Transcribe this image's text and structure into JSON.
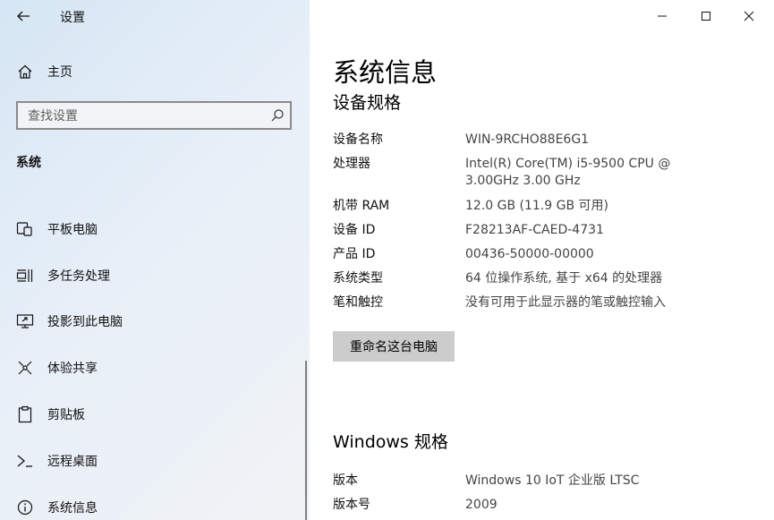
{
  "window": {
    "app_title": "设置"
  },
  "sidebar": {
    "home_label": "主页",
    "search_placeholder": "查找设置",
    "section_header": "系统",
    "items": [
      {
        "label": "平板电脑",
        "icon": "tablet-icon"
      },
      {
        "label": "多任务处理",
        "icon": "multitasking-icon"
      },
      {
        "label": "投影到此电脑",
        "icon": "project-icon"
      },
      {
        "label": "体验共享",
        "icon": "share-icon"
      },
      {
        "label": "剪贴板",
        "icon": "clipboard-icon"
      },
      {
        "label": "远程桌面",
        "icon": "remote-desktop-icon"
      },
      {
        "label": "系统信息",
        "icon": "info-icon"
      }
    ]
  },
  "main": {
    "page_title": "系统信息",
    "device_specs": {
      "title": "设备规格",
      "rows": [
        {
          "label": "设备名称",
          "value": "WIN-9RCHO88E6G1"
        },
        {
          "label": "处理器",
          "value": "Intel(R) Core(TM) i5-9500 CPU @ 3.00GHz 3.00 GHz"
        },
        {
          "label": "机带 RAM",
          "value": "12.0 GB (11.9 GB 可用)"
        },
        {
          "label": "设备 ID",
          "value": "F28213AF-CAED-4731"
        },
        {
          "label": "产品 ID",
          "value": "00436-50000-00000"
        },
        {
          "label": "系统类型",
          "value": "64 位操作系统, 基于 x64 的处理器"
        },
        {
          "label": "笔和触控",
          "value": "没有可用于此显示器的笔或触控输入"
        }
      ],
      "rename_button": "重命名这台电脑"
    },
    "windows_specs": {
      "title": "Windows 规格",
      "rows": [
        {
          "label": "版本",
          "value": "Windows 10 IoT 企业版 LTSC"
        },
        {
          "label": "版本号",
          "value": "2009"
        }
      ]
    }
  }
}
